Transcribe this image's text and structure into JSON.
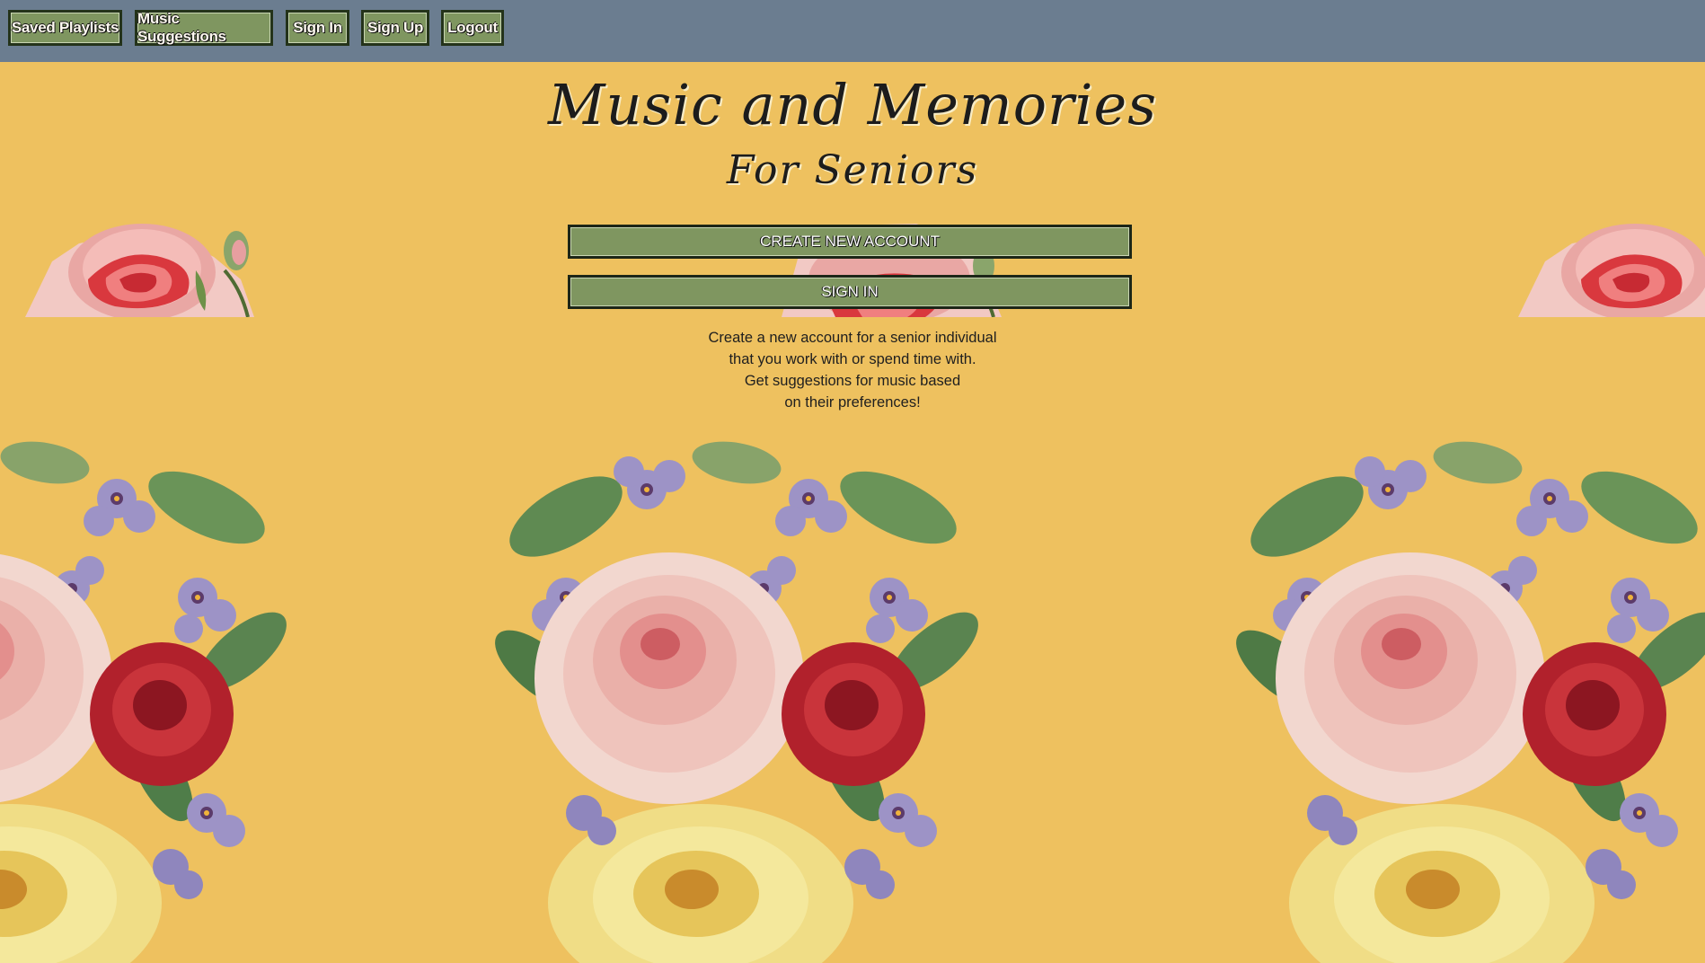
{
  "nav": {
    "saved_playlists": "Saved Playlists",
    "music_suggestions": "Music Suggestions",
    "sign_in": "Sign In",
    "sign_up": "Sign Up",
    "logout": "Logout"
  },
  "header": {
    "title": "Music and Memories",
    "subtitle": "For Seniors"
  },
  "actions": {
    "create_account": "CREATE NEW ACCOUNT",
    "sign_in": "SIGN IN"
  },
  "description": {
    "line1": "Create a new account for a senior individual",
    "line2": "that you work with or spend time with.",
    "line3": "Get suggestions for music based",
    "line4": "on their preferences!"
  },
  "colors": {
    "page_background": "#eec15f",
    "nav_background": "#6b7d90",
    "button_fill": "#7f9660",
    "button_border": "#1c2617"
  },
  "images": {
    "rose_strip": "pink-rose-decorative-image",
    "floral_band": "vintage-roses-and-violets-image"
  }
}
